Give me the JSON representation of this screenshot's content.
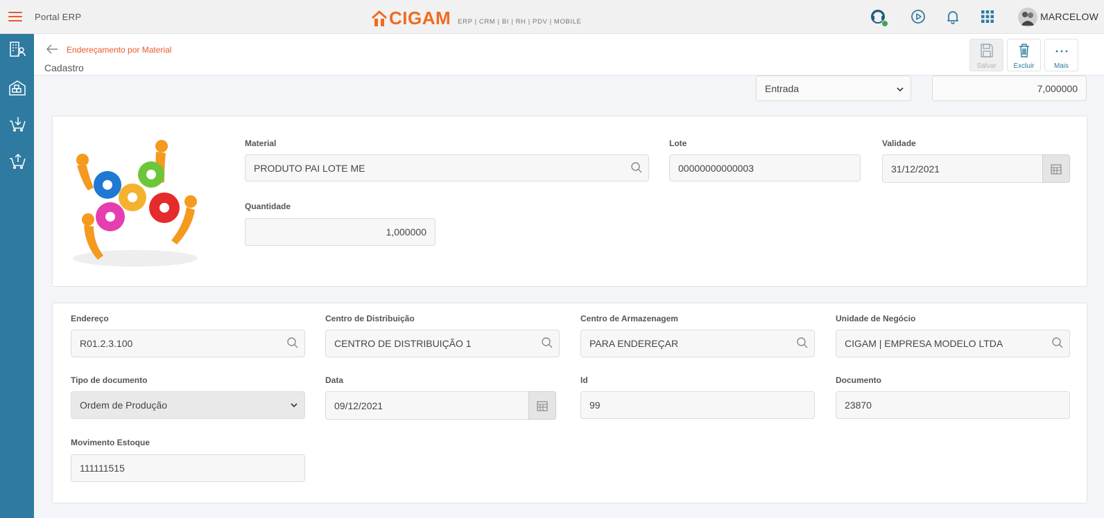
{
  "topbar": {
    "portal_title": "Portal ERP",
    "logo_text": "CIGAM",
    "logo_sub": "ERP | CRM | BI | RH | PDV | MOBILE",
    "username": "MARCELOW",
    "icons": [
      "support-icon",
      "play-icon",
      "bell-icon",
      "apps-grid-icon"
    ],
    "accent": "#e8592a",
    "status_color": "#3aa655"
  },
  "leftnav": {
    "background": "#2e7aa0",
    "icons": [
      "building-user-icon",
      "warehouse-icon",
      "cart-in-icon",
      "cart-out-icon"
    ]
  },
  "header": {
    "breadcrumb": "Endereçamento por Material",
    "subtitle": "Cadastro",
    "buttons": {
      "save": "Salvar",
      "delete": "Excluir",
      "more": "Mais"
    }
  },
  "top_row": {
    "direction_select": "Entrada",
    "quantity_value": "7,000000"
  },
  "material_card": {
    "material_label": "Material",
    "material_value": "PRODUTO PAI LOTE ME",
    "lote_label": "Lote",
    "lote_value": "00000000000003",
    "validade_label": "Validade",
    "validade_value": "31/12/2021",
    "quantidade_label": "Quantidade",
    "quantidade_value": "1,000000"
  },
  "details_card": {
    "endereco_label": "Endereço",
    "endereco_value": "R01.2.3.100",
    "centro_dist_label": "Centro de Distribuição",
    "centro_dist_value": "CENTRO DE DISTRIBUIÇÃO 1",
    "centro_arm_label": "Centro de Armazenagem",
    "centro_arm_value": "PARA ENDEREÇAR",
    "unidade_label": "Unidade de Negócio",
    "unidade_value": "CIGAM | EMPRESA MODELO LTDA",
    "tipo_doc_label": "Tipo de documento",
    "tipo_doc_value": "Ordem de Produção",
    "data_label": "Data",
    "data_value": "09/12/2021",
    "id_label": "Id",
    "id_value": "99",
    "documento_label": "Documento",
    "documento_value": "23870",
    "movimento_label": "Movimento Estoque",
    "movimento_value": "111111515"
  }
}
